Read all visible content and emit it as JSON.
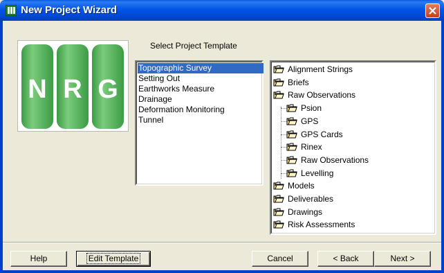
{
  "window": {
    "title": "New Project Wizard",
    "icon": "nrg-app-icon",
    "close_icon": "close-icon"
  },
  "logo": {
    "letters": [
      "N",
      "R",
      "G"
    ],
    "color": "#5cb85c"
  },
  "template_prompt": "Select Project Template",
  "templates": [
    {
      "label": "Topographic Survey",
      "selected": true
    },
    {
      "label": "Setting Out",
      "selected": false
    },
    {
      "label": "Earthworks Measure",
      "selected": false
    },
    {
      "label": "Drainage",
      "selected": false
    },
    {
      "label": "Deformation Monitoring",
      "selected": false
    },
    {
      "label": "Tunnel",
      "selected": false
    }
  ],
  "tree": [
    {
      "label": "Alignment Strings",
      "level": 0
    },
    {
      "label": "Briefs",
      "level": 0
    },
    {
      "label": "Raw Observations",
      "level": 0
    },
    {
      "label": "Psion",
      "level": 1
    },
    {
      "label": "GPS",
      "level": 1
    },
    {
      "label": "GPS Cards",
      "level": 1
    },
    {
      "label": "Rinex",
      "level": 1
    },
    {
      "label": "Raw Observations",
      "level": 1
    },
    {
      "label": "Levelling",
      "level": 1
    },
    {
      "label": "Models",
      "level": 0
    },
    {
      "label": "Deliverables",
      "level": 0
    },
    {
      "label": "Drawings",
      "level": 0
    },
    {
      "label": "Risk Assessments",
      "level": 0
    }
  ],
  "buttons": {
    "help": "Help",
    "edit_template": "Edit Template",
    "cancel": "Cancel",
    "back": "< Back",
    "next": "Next >"
  }
}
